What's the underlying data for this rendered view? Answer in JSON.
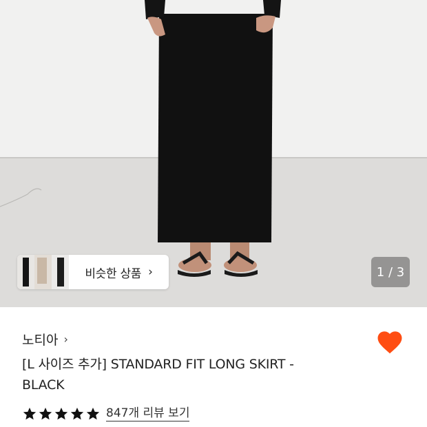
{
  "gallery": {
    "similar_label": "비슷한 상품",
    "similar_chevron": "›",
    "pager_text": "1 / 3"
  },
  "product": {
    "brand": "노티아",
    "brand_chevron": "›",
    "title": "[L 사이즈 추가] STANDARD FIT LONG SKIRT - BLACK",
    "rating": 5,
    "rating_max": 5,
    "reviews_link": "847개 리뷰 보기",
    "liked": true
  },
  "colors": {
    "heart": "#ff4d12",
    "star": "#111111",
    "pager_bg": "rgba(90,90,90,0.55)"
  },
  "icons": {
    "like": "heart-icon",
    "rating": "star-icon",
    "chevron": "chevron-right-icon"
  }
}
